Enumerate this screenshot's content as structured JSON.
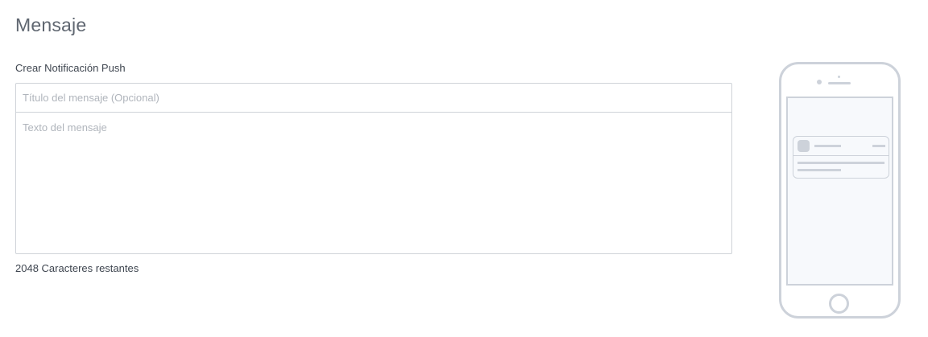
{
  "section": {
    "title": "Mensaje"
  },
  "form": {
    "label": "Crear Notificación Push",
    "title_input": {
      "value": "",
      "placeholder": "Título del mensaje (Opcional)"
    },
    "body_textarea": {
      "value": "",
      "placeholder": "Texto del mensaje"
    },
    "char_counter": {
      "remaining": "2048",
      "suffix": "Caracteres restantes"
    }
  },
  "preview": {
    "device": "phone-icon",
    "notification": "notification-placeholder-icon",
    "outline_color": "#cdd2da",
    "screen_color": "#f7f9fc"
  }
}
